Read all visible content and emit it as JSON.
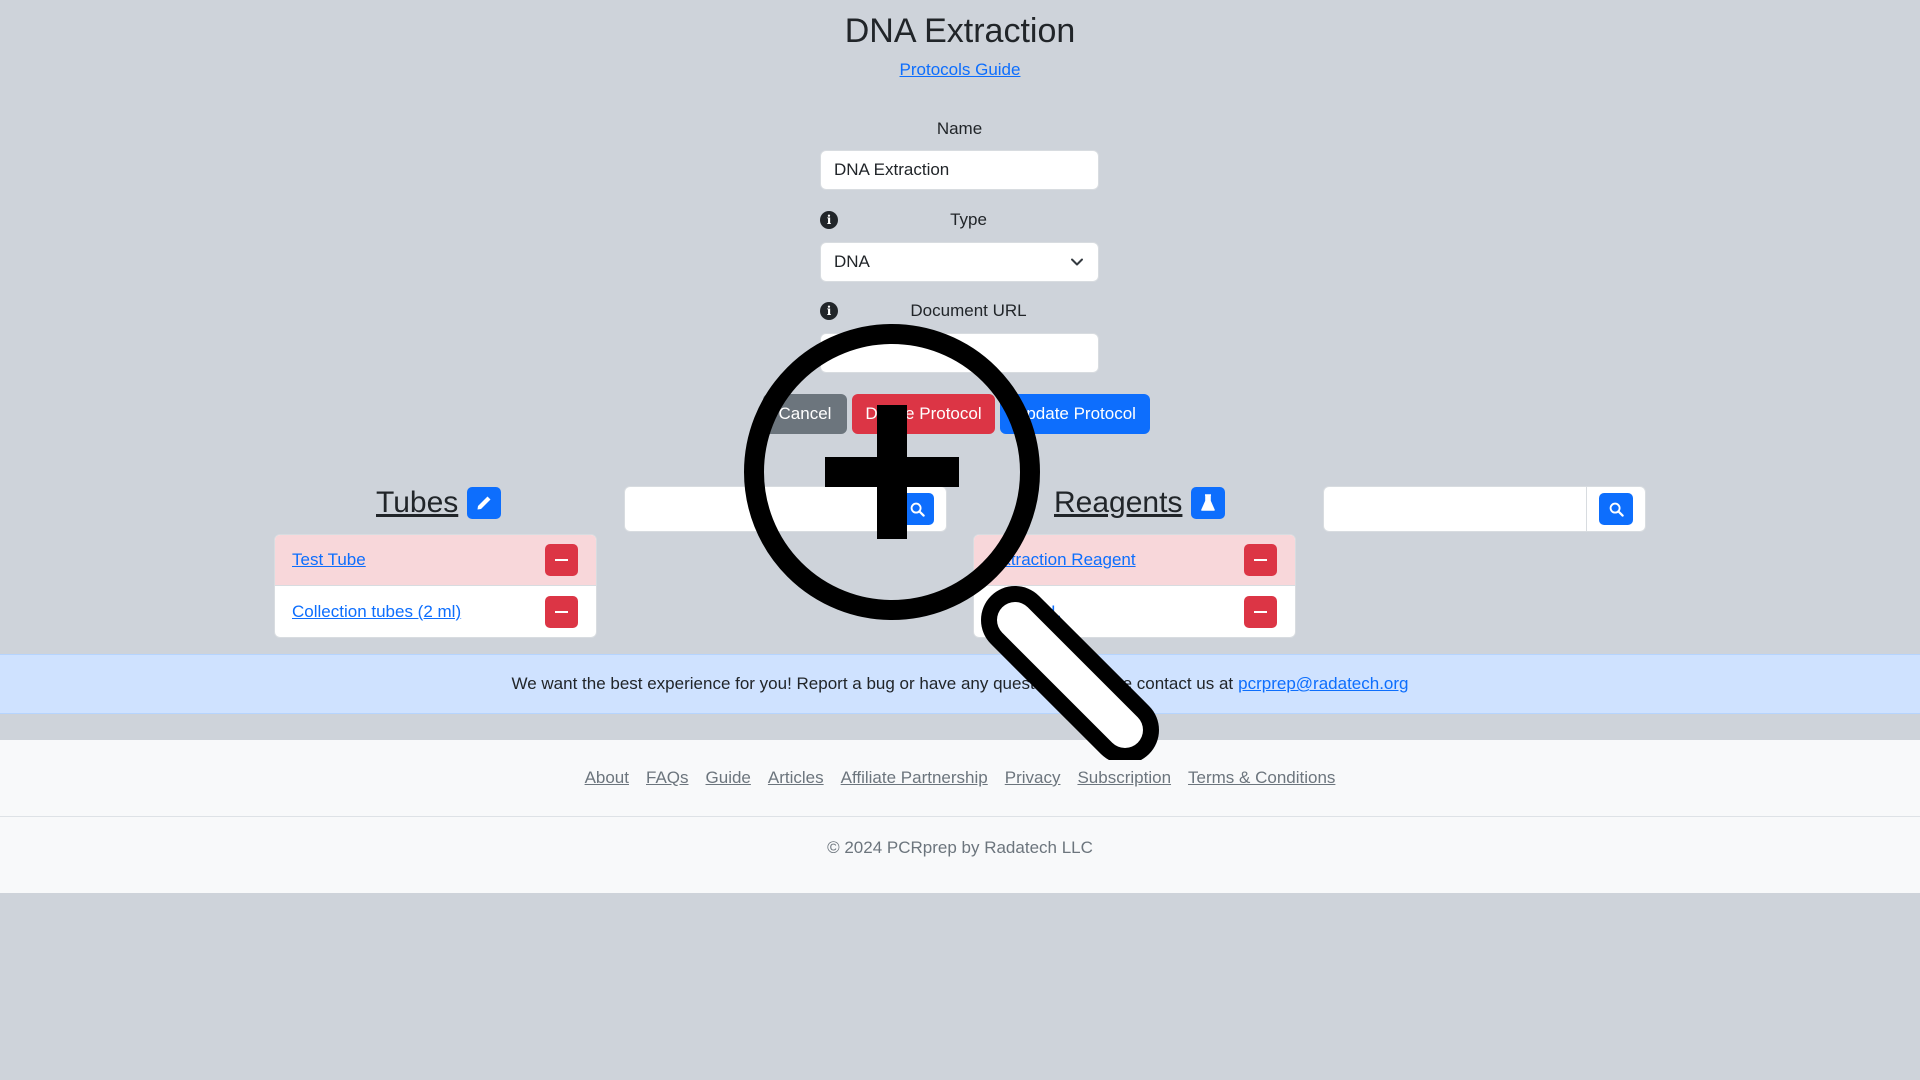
{
  "header": {
    "title": "DNA Extraction",
    "guide_link": "Protocols Guide"
  },
  "form": {
    "name_label": "Name",
    "name_value": "DNA Extraction",
    "type_label": "Type",
    "type_value": "DNA",
    "doc_url_label": "Document URL",
    "doc_url_value": ""
  },
  "actions": {
    "cancel": "Cancel",
    "delete": "Delete Protocol",
    "update": "Update Protocol"
  },
  "tubes": {
    "title": "Tubes",
    "search_value": "",
    "items": [
      {
        "label": "Test Tube",
        "highlight": true
      },
      {
        "label": "Collection tubes (2 ml)",
        "highlight": false
      }
    ]
  },
  "reagents": {
    "title": "Reagents",
    "search_value": "",
    "items": [
      {
        "label": "Extraction Reagent",
        "highlight": true
      },
      {
        "label": "Buffer AL",
        "highlight": false
      }
    ]
  },
  "banner": {
    "text": "We want the best experience for you! Report a bug or have any questions? Please contact us at",
    "email": "pcrprep@radatech.org"
  },
  "footer": {
    "links": [
      "About",
      "FAQs",
      "Guide",
      "Articles",
      "Affiliate Partnership",
      "Privacy",
      "Subscription",
      "Terms & Conditions"
    ],
    "copyright": "© 2024 PCRprep by Radatech LLC"
  },
  "colors": {
    "background": "#ced3da",
    "primary": "#0d6efd",
    "danger": "#dc3545",
    "secondary": "#6c757d",
    "banner": "#cfe2ff"
  },
  "icons": [
    "info-icon",
    "chevron-down-icon",
    "pencil-icon",
    "flask-icon",
    "search-icon",
    "minus-icon",
    "zoom-in-magnifier-icon"
  ]
}
